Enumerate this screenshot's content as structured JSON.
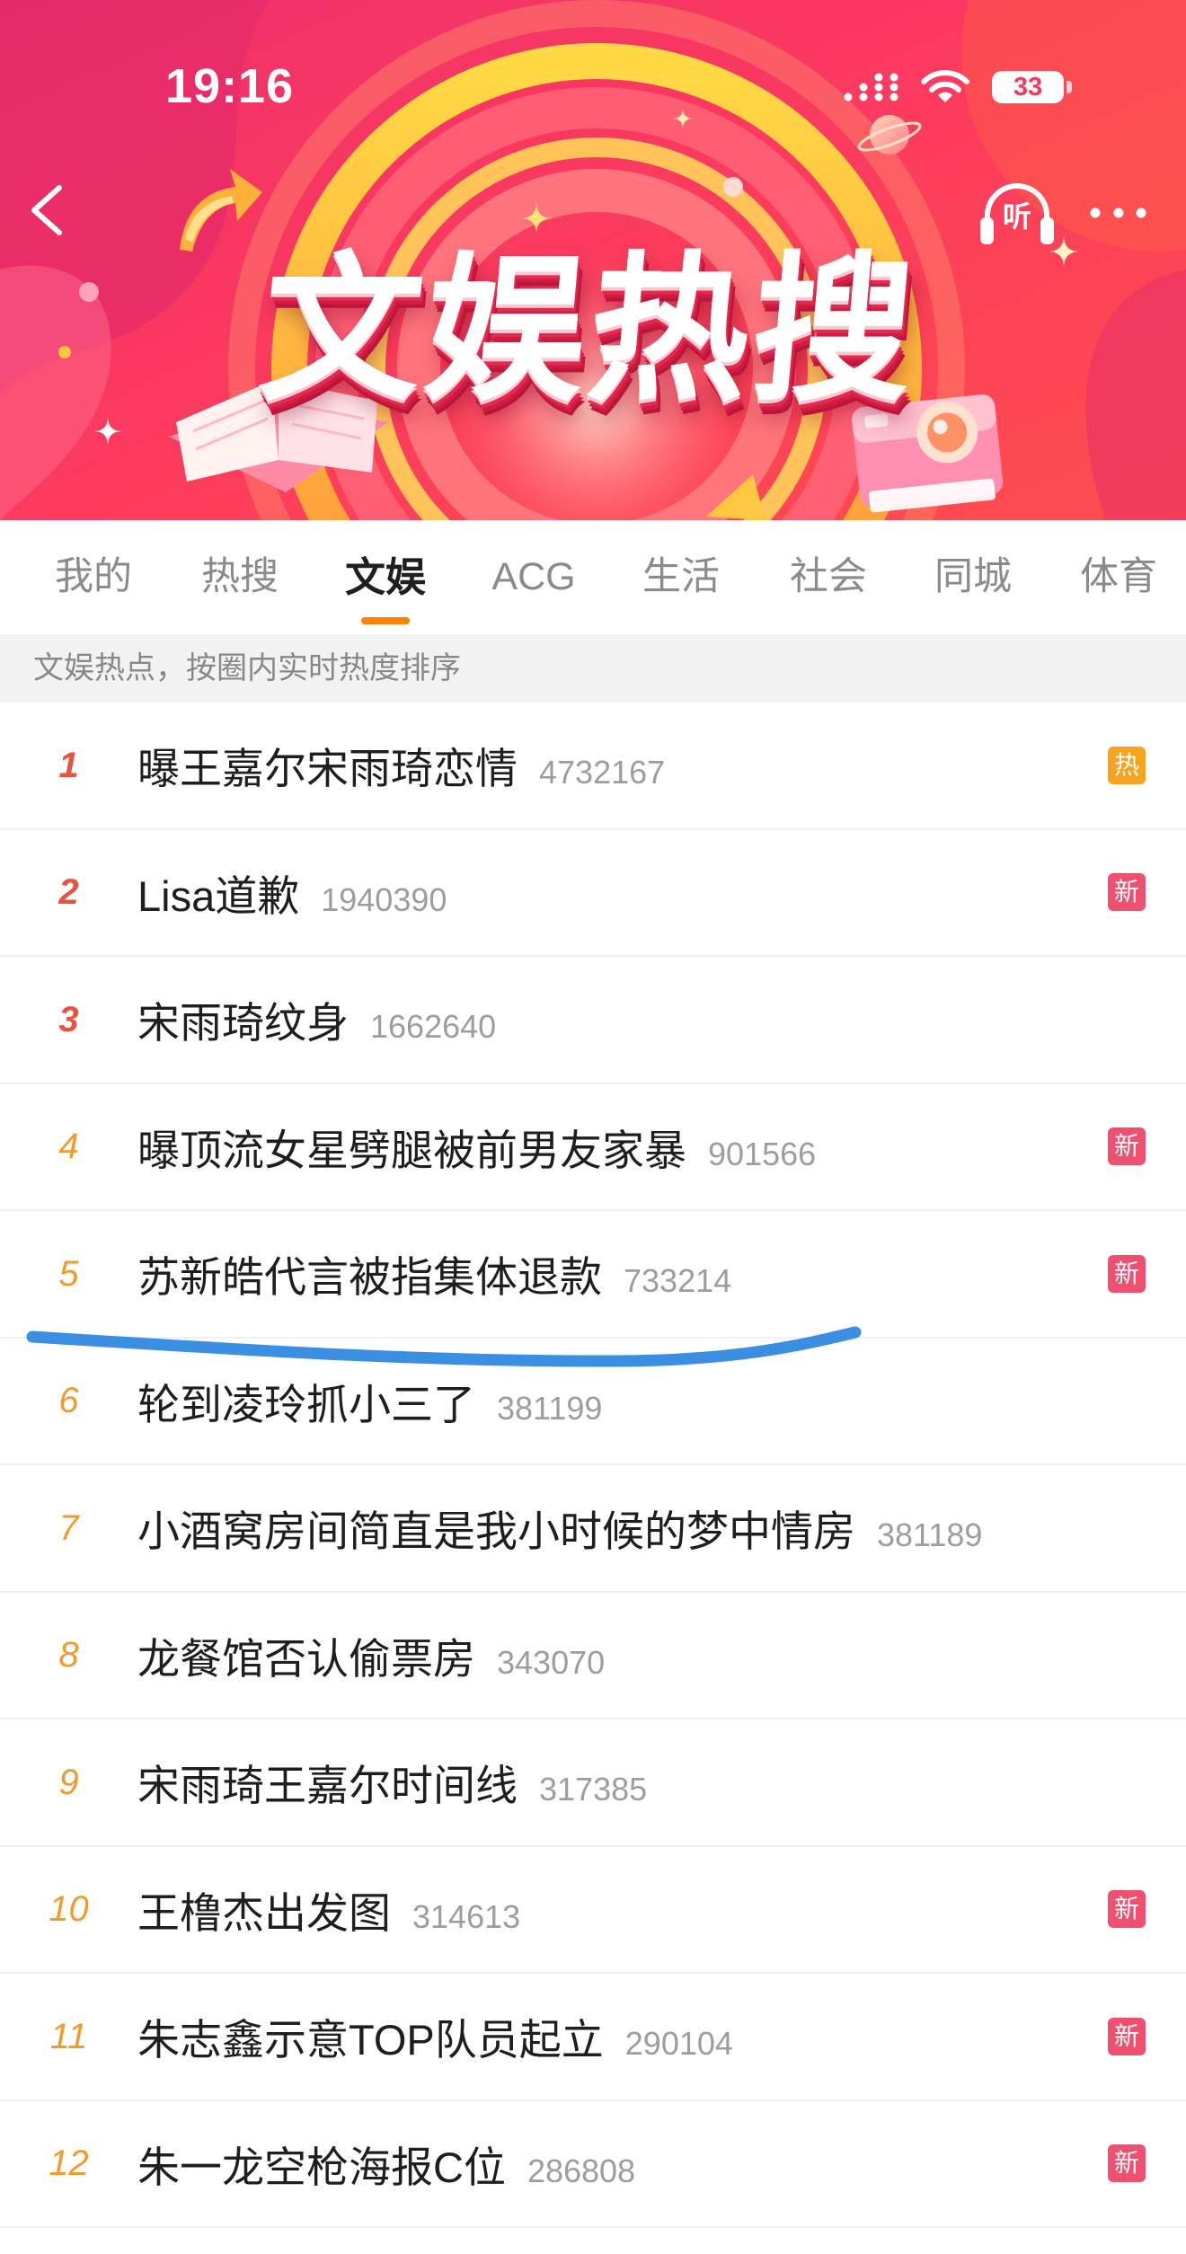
{
  "status_bar": {
    "time": "19:16",
    "battery": "33",
    "icons": [
      "signal-icon",
      "wifi-icon",
      "battery-icon"
    ]
  },
  "header": {
    "title": "文娱热搜",
    "listen_label": "听",
    "icons": {
      "back": "chevron-left-icon",
      "listen": "headphones-icon",
      "more": "more-dots-icon"
    }
  },
  "tabs": [
    {
      "label": "我的"
    },
    {
      "label": "热搜"
    },
    {
      "label": "文娱",
      "active": true
    },
    {
      "label": "ACG"
    },
    {
      "label": "生活"
    },
    {
      "label": "社会"
    },
    {
      "label": "同城"
    },
    {
      "label": "体育"
    }
  ],
  "subheader": {
    "text": "文娱热点，按圈内实时热度排序"
  },
  "list": [
    {
      "rank": "1",
      "title": "曝王嘉尔宋雨琦恋情",
      "count": "4732167",
      "badge": "热"
    },
    {
      "rank": "2",
      "title": "Lisa道歉",
      "count": "1940390",
      "badge": "新"
    },
    {
      "rank": "3",
      "title": "宋雨琦纹身",
      "count": "1662640"
    },
    {
      "rank": "4",
      "title": "曝顶流女星劈腿被前男友家暴",
      "count": "901566",
      "badge": "新"
    },
    {
      "rank": "5",
      "title": "苏新皓代言被指集体退款",
      "count": "733214",
      "badge": "新"
    },
    {
      "rank": "6",
      "title": "轮到凌玲抓小三了",
      "count": "381199"
    },
    {
      "rank": "7",
      "title": "小酒窝房间简直是我小时候的梦中情房",
      "count": "381189"
    },
    {
      "rank": "8",
      "title": "龙餐馆否认偷票房",
      "count": "343070"
    },
    {
      "rank": "9",
      "title": "宋雨琦王嘉尔时间线",
      "count": "317385"
    },
    {
      "rank": "10",
      "title": "王橹杰出发图",
      "count": "314613",
      "badge": "新"
    },
    {
      "rank": "11",
      "title": "朱志鑫示意TOP队员起立",
      "count": "290104",
      "badge": "新"
    },
    {
      "rank": "12",
      "title": "朱一龙空枪海报C位",
      "count": "286808",
      "badge": "新"
    }
  ],
  "colors": {
    "banner_red": "#fb3a5c",
    "tab_indicator": "#ff8200",
    "rank_top": "#e8533f",
    "rank_other": "#f29b2c",
    "badge_hot": "#f6a31f",
    "badge_new": "#f0506f",
    "annotation_blue": "#3a8fe3"
  }
}
